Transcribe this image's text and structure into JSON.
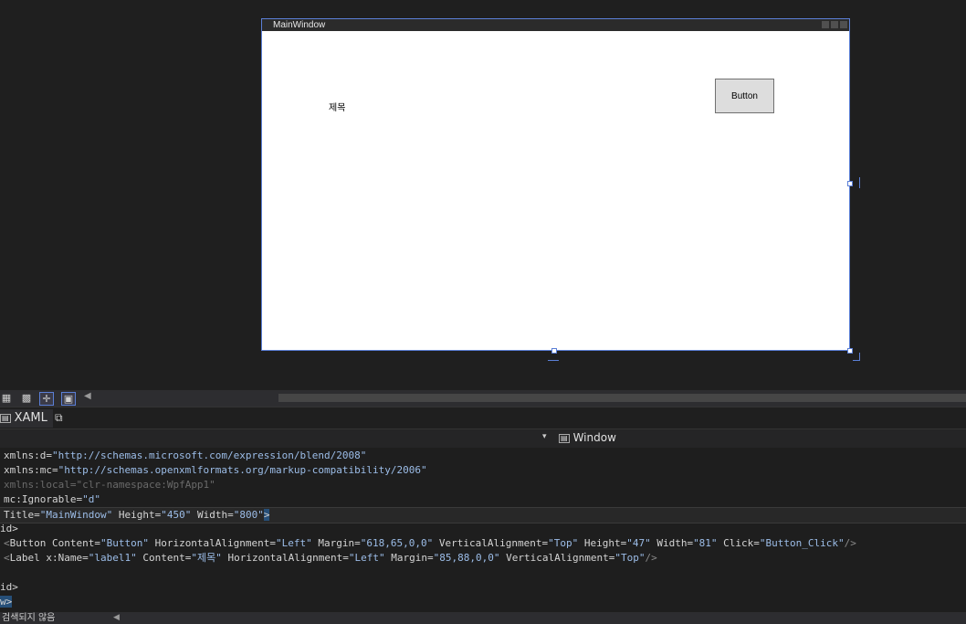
{
  "designer": {
    "window_title": "MainWindow",
    "label_text": "제목",
    "button_text": "Button"
  },
  "zoombar": {
    "icons": [
      "grid-icon",
      "checker-icon",
      "snap-icon",
      "layout-icon"
    ],
    "arrow": "◀"
  },
  "tabs": {
    "xaml_label": "XAML",
    "popout_icon": "popout-icon"
  },
  "selector": {
    "element": "Window",
    "dropdown_arrow": "▾"
  },
  "code": {
    "line1_attr": "xmlns:d=",
    "line1_val": "\"http://schemas.microsoft.com/expression/blend/2008\"",
    "line2_attr": "xmlns:mc=",
    "line2_val": "\"http://schemas.openxmlformats.org/markup-compatibility/2006\"",
    "line3_attr": "xmlns:local=",
    "line3_val": "\"clr-namespace:WpfApp1\"",
    "line4_attr": "mc:Ignorable=",
    "line4_val": "\"d\"",
    "line5_attr1": "Title=",
    "line5_val1": "\"MainWindow\"",
    "line5_attr2": " Height=",
    "line5_val2": "\"450\"",
    "line5_attr3": " Width=",
    "line5_val3": "\"800\"",
    "line5_end": ">",
    "line6": "id>",
    "line7_open": "<",
    "line7_tag": "Button ",
    "line7_a1": "Content=",
    "line7_v1": "\"Button\"",
    "line7_a2": " HorizontalAlignment=",
    "line7_v2": "\"Left\"",
    "line7_a3": " Margin=",
    "line7_v3": "\"618,65,0,0\"",
    "line7_a4": " VerticalAlignment=",
    "line7_v4": "\"Top\"",
    "line7_a5": " Height=",
    "line7_v5": "\"47\"",
    "line7_a6": " Width=",
    "line7_v6": "\"81\"",
    "line7_a7": " Click=",
    "line7_v7": "\"Button_Click\"",
    "line7_close": "/>",
    "line8_open": "<",
    "line8_tag": "Label ",
    "line8_a1": "x:Name=",
    "line8_v1": "\"label1\"",
    "line8_a2": " Content=",
    "line8_v2": "\"제목\"",
    "line8_a3": " HorizontalAlignment=",
    "line8_v3": "\"Left\"",
    "line8_a4": " Margin=",
    "line8_v4": "\"85,88,0,0\"",
    "line8_a5": " VerticalAlignment=",
    "line8_v5": "\"Top\"",
    "line8_close": "/>",
    "line10": "id>",
    "line11": "w>"
  },
  "status": {
    "text": "검색되지 않음",
    "arrow": "◀"
  },
  "colors": {
    "background": "#1f1f1f",
    "accent": "#5b7fd6",
    "string_value": "#9cbde8"
  }
}
